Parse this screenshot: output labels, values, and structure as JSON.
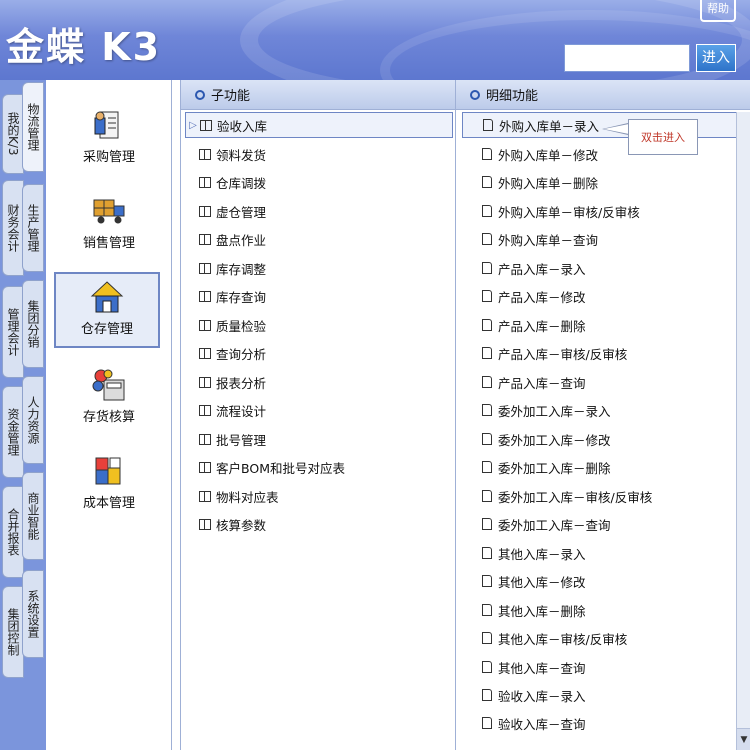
{
  "header": {
    "logo_text": "金蝶 K3",
    "help_label": "帮助",
    "search_value": "",
    "enter_label": "进入"
  },
  "tabs": [
    {
      "label": "我的K/3"
    },
    {
      "label": "物流管理",
      "active": true
    },
    {
      "label": "财务会计"
    },
    {
      "label": "生产管理"
    },
    {
      "label": "管理会计"
    },
    {
      "label": "集团分销"
    },
    {
      "label": "资金管理"
    },
    {
      "label": "人力资源"
    },
    {
      "label": "合并报表"
    },
    {
      "label": "商业智能"
    },
    {
      "label": "集团控制"
    },
    {
      "label": "系统设置"
    }
  ],
  "modules": [
    {
      "label": "采购管理",
      "icon": "purchase-icon"
    },
    {
      "label": "销售管理",
      "icon": "sales-truck-icon"
    },
    {
      "label": "仓存管理",
      "icon": "warehouse-icon",
      "active": true
    },
    {
      "label": "存货核算",
      "icon": "inventory-calc-icon"
    },
    {
      "label": "成本管理",
      "icon": "cost-icon"
    }
  ],
  "sub_panel": {
    "title": "子功能",
    "items": [
      "验收入库",
      "领料发货",
      "仓库调拨",
      "虚仓管理",
      "盘点作业",
      "库存调整",
      "库存查询",
      "质量检验",
      "查询分析",
      "报表分析",
      "流程设计",
      "批号管理",
      "客户BOM和批号对应表",
      "物料对应表",
      "核算参数"
    ]
  },
  "detail_panel": {
    "title": "明细功能",
    "items": [
      "外购入库单－录入",
      "外购入库单－修改",
      "外购入库单－删除",
      "外购入库单－审核/反审核",
      "外购入库单－查询",
      "产品入库－录入",
      "产品入库－修改",
      "产品入库－删除",
      "产品入库－审核/反审核",
      "产品入库－查询",
      "委外加工入库－录入",
      "委外加工入库－修改",
      "委外加工入库－删除",
      "委外加工入库－审核/反审核",
      "委外加工入库－查询",
      "其他入库－录入",
      "其他入库－修改",
      "其他入库－删除",
      "其他入库－审核/反审核",
      "其他入库－查询",
      "验收入库－录入",
      "验收入库－查询"
    ],
    "callout": "双击进入"
  }
}
